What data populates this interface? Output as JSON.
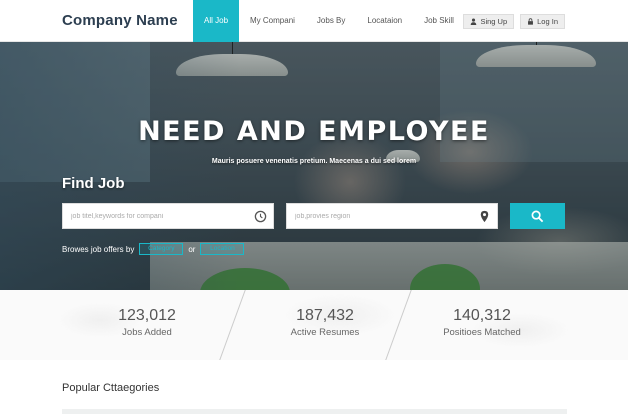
{
  "header": {
    "logo": "Company Name",
    "nav": [
      "All Job",
      "My Compani",
      "Jobs By",
      "Locataion",
      "Job Skill"
    ],
    "active_index": 0,
    "signup_label": "Sing Up",
    "login_label": "Log In"
  },
  "hero": {
    "headline": "NEED AND EMPLOYEE",
    "subline": "Mauris posuere venenatis pretium. Maecenas a dui sed lorem",
    "find_label": "Find Job",
    "keyword_placeholder": "job titel,keywords for compani",
    "location_placeholder": "job,provies region",
    "browse_label": "Browes job offers by",
    "or_label": "or",
    "browse_btn_1": "Category",
    "browse_btn_2": "Location"
  },
  "stats": [
    {
      "value": "123,012",
      "label": "Jobs Added"
    },
    {
      "value": "187,432",
      "label": "Active Resumes"
    },
    {
      "value": "140,312",
      "label": "Positioes Matched"
    }
  ],
  "section": {
    "popular_title": "Popular Cttaegories"
  },
  "icons": {
    "user": "user-icon",
    "lock": "lock-icon",
    "clock": "clock-icon",
    "pin": "location-pin-icon",
    "search": "search-icon"
  },
  "colors": {
    "accent": "#1ab8c8",
    "logo": "#2c3e50"
  }
}
